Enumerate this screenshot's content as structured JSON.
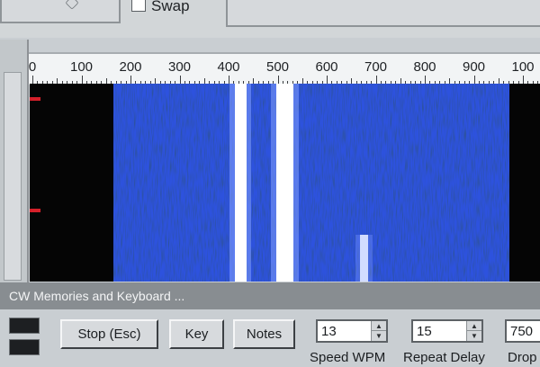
{
  "top": {
    "swap_label": "Swap"
  },
  "ruler": {
    "labels": [
      "0",
      "100",
      "200",
      "300",
      "400",
      "500",
      "600",
      "700",
      "800",
      "900",
      "100"
    ]
  },
  "panel": {
    "caption": "CW Memories and Keyboard ..."
  },
  "buttons": {
    "stop": "Stop (Esc)",
    "key": "Key",
    "notes": "Notes"
  },
  "fields": {
    "speed": {
      "label": "Speed WPM",
      "value": "13"
    },
    "repeat": {
      "label": "Repeat Delay",
      "value": "15"
    },
    "drop": {
      "label": "Drop",
      "value": "750"
    }
  },
  "colors": {
    "waterfall_blue": "#1536c8",
    "signal": "#ffffff",
    "marker": "#d4202a",
    "caption_bg": "#888d91"
  }
}
